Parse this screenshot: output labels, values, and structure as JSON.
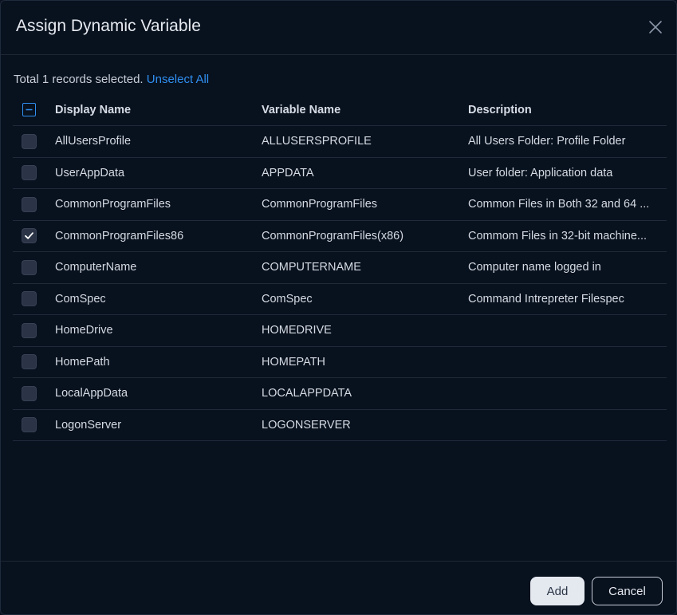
{
  "dialog": {
    "title": "Assign Dynamic Variable",
    "close_icon": "close-icon"
  },
  "selection": {
    "text": "Total 1 records selected.",
    "unselect_label": "Unselect All"
  },
  "table": {
    "columns": [
      "Display Name",
      "Variable Name",
      "Description"
    ],
    "header_checkbox_state": "indeterminate",
    "rows": [
      {
        "display": "AllUsersProfile",
        "variable": "ALLUSERSPROFILE",
        "description": "All Users Folder: Profile Folder",
        "checked": false
      },
      {
        "display": "UserAppData",
        "variable": "APPDATA",
        "description": "User folder: Application data",
        "checked": false
      },
      {
        "display": "CommonProgramFiles",
        "variable": "CommonProgramFiles",
        "description": "Common Files in Both 32 and 64 ...",
        "checked": false
      },
      {
        "display": "CommonProgramFiles86",
        "variable": "CommonProgramFiles(x86)",
        "description": "Commom Files in 32-bit machine...",
        "checked": true
      },
      {
        "display": "ComputerName",
        "variable": "COMPUTERNAME",
        "description": "Computer name logged in",
        "checked": false
      },
      {
        "display": "ComSpec",
        "variable": "ComSpec",
        "description": "Command Intrepreter Filespec",
        "checked": false
      },
      {
        "display": "HomeDrive",
        "variable": "HOMEDRIVE",
        "description": "",
        "checked": false
      },
      {
        "display": "HomePath",
        "variable": "HOMEPATH",
        "description": "",
        "checked": false
      },
      {
        "display": "LocalAppData",
        "variable": "LOCALAPPDATA",
        "description": "",
        "checked": false
      },
      {
        "display": "LogonServer",
        "variable": "LOGONSERVER",
        "description": "",
        "checked": false
      }
    ]
  },
  "footer": {
    "add_label": "Add",
    "cancel_label": "Cancel"
  },
  "colors": {
    "background": "#08111e",
    "accent": "#2f8ff0",
    "border": "#1f2a3a"
  }
}
